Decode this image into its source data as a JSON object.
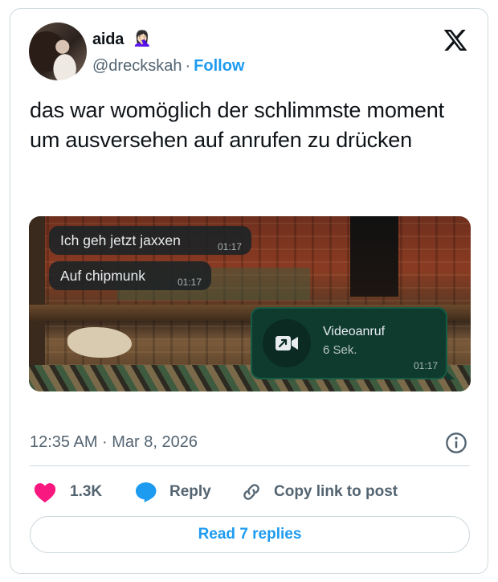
{
  "tweet": {
    "author": {
      "display_name": "aida",
      "emoji": "🤦🏻‍♀️",
      "handle": "@dreckskah",
      "separator": "·",
      "follow_label": "Follow"
    },
    "text": "das war womöglich der schlimmste moment um ausversehen auf anrufen zu drücken",
    "media": {
      "messages": [
        {
          "text": "Ich geh jetzt jaxxen",
          "time": "01:17"
        },
        {
          "text": "Auf chipmunk",
          "time": "01:17"
        }
      ],
      "call": {
        "title": "Videoanruf",
        "duration": "6 Sek.",
        "time": "01:17"
      }
    },
    "timestamp": "12:35 AM · Mar 8, 2026",
    "actions": {
      "likes_count": "1.3K",
      "reply_label": "Reply",
      "copy_label": "Copy link to post"
    },
    "read_replies_label": "Read 7 replies"
  },
  "colors": {
    "accent": "#1d9bf0",
    "like": "#f91880",
    "secondary_text": "#536471",
    "border": "#cfd9de",
    "call_bubble": "#0f3b2f"
  },
  "icons": {
    "brand": "x-logo-icon",
    "info": "info-icon",
    "like": "heart-icon",
    "reply": "speech-bubble-icon",
    "copy": "link-icon",
    "call": "video-call-outgoing-icon"
  }
}
